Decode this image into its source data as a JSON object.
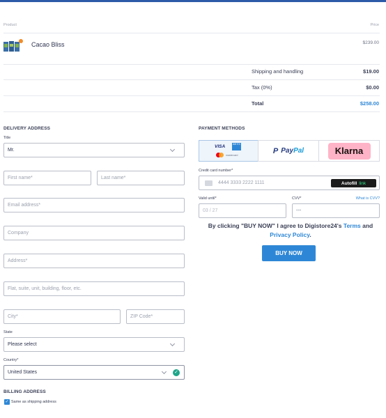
{
  "cart": {
    "col_product": "Product",
    "col_price": "Price",
    "item": {
      "name": "Cacao Bliss",
      "price": "$239.00",
      "badge": "!"
    },
    "summary": [
      {
        "label": "Shipping and handling",
        "value": "$19.00"
      },
      {
        "label": "Tax (0%)",
        "value": "$0.00"
      },
      {
        "label": "Total",
        "value": "$258.00"
      }
    ]
  },
  "delivery": {
    "heading": "DELIVERY ADDRESS",
    "title_label": "Title",
    "title_value": "Mr.",
    "first_name_ph": "First name*",
    "last_name_ph": "Last name*",
    "email_ph": "Email address*",
    "company_ph": "Company",
    "address_ph": "Address*",
    "address2_ph": "Flat, suite, unit, building, floor, etc.",
    "city_ph": "City*",
    "zip_ph": "ZIP Code*",
    "state_label": "State",
    "state_value": "Please select",
    "country_label": "Country*",
    "country_value": "United States"
  },
  "billing": {
    "heading": "BILLING ADDRESS",
    "same_label": "Same as shipping address",
    "same_checked": true
  },
  "payment": {
    "heading": "PAYMENT METHODS",
    "methods": [
      {
        "name": "Cards",
        "visa": "VISA",
        "amex": "AM EX",
        "mc": "mastercard"
      },
      {
        "name": "PayPal",
        "pay": "Pay",
        "pal": "Pal"
      },
      {
        "name": "Klarna",
        "label": "Klarna"
      }
    ],
    "card_label": "Credit card number*",
    "card_ph": "4444 3333 2222 1111",
    "autofill": "Autofill",
    "autofill_link": "link",
    "valid_label": "Valid until*",
    "valid_ph": "03 / 27",
    "cvv_label": "CVV*",
    "cvv_help": "What is CVV?",
    "cvv_ph": "•••",
    "agree_pre": "By clicking \"BUY NOW\" I agree to Digistore24's ",
    "agree_terms": "Terms",
    "agree_and": " and ",
    "agree_privacy": "Privacy Policy",
    "agree_end": ".",
    "buy_label": "BUY NOW"
  },
  "colors": {
    "accent": "#2e87d6",
    "topbar": "#2d5aa8",
    "klarna": "#ffb3c7",
    "success": "#1ea58a"
  }
}
